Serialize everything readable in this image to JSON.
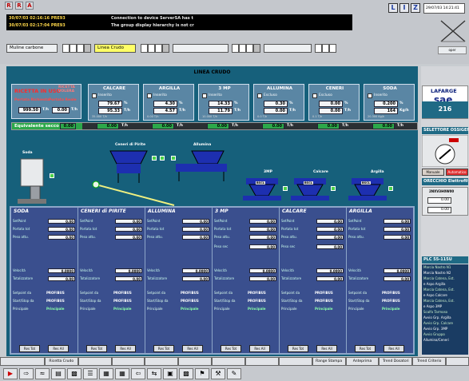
{
  "alarms": [
    {
      "date": "30/07/03 02:16:16 PRE93",
      "text": "Connection to device ServerSA has t"
    },
    {
      "date": "30/07/03 02:17:04 PRE93",
      "text": "The group display hierarchy is not cr"
    }
  ],
  "toolbar": {
    "icon1": "R",
    "icon2": "R",
    "icon3": "A"
  },
  "sysbuttons": [
    "L",
    "I",
    "Z"
  ],
  "clock": "29/07/03 14:21:41",
  "user_field": "oper",
  "nav": {
    "tab1": "Muline carbone",
    "tab2": "Linea Crudo"
  },
  "panel": {
    "title": "LINEA CRUDO"
  },
  "recipe": {
    "label": "RICETTA IN USO",
    "sub_right": "RICETTA VOLERA",
    "portata_richiesta": "Portata Richiesta",
    "portata_reale": "Portata Reale",
    "val1": "999.50",
    "val2": "0.00",
    "unit": "T/h"
  },
  "equivalent": {
    "label": "Equivalente secco",
    "v0": "0.00",
    "unit": "T/h"
  },
  "materials": [
    {
      "name": "CALCARE",
      "ins": "Inserito",
      "v1": "79.67",
      "u1": "%",
      "v2": "95.33",
      "u2": "T/h",
      "small": "35.000 T/h",
      "eq": "0.00"
    },
    {
      "name": "ARGILLA",
      "ins": "Inserito",
      "v1": "4.30",
      "u1": "%",
      "v2": "4.57",
      "u2": "T/h",
      "small": "0.00 T/h",
      "eq": "0.00"
    },
    {
      "name": "3 MP",
      "ins": "Inserito",
      "v1": "14.33",
      "u1": "%",
      "v2": "11.79",
      "u2": "T/h",
      "small": "10.000 T/h",
      "eq": "0.00"
    },
    {
      "name": "ALLUMINA",
      "ins": "Escluso",
      "v1": "0.30",
      "u1": "%",
      "v2": "0.00",
      "u2": "T/h",
      "small": "0.0 T/h",
      "eq": "0.00"
    },
    {
      "name": "CENERI",
      "ins": "Escluso",
      "v1": "0.00",
      "u1": "%",
      "v2": "0.00",
      "u2": "T/h",
      "small": "0.1 T/h",
      "eq": "0.00"
    },
    {
      "name": "SODA",
      "ins": "Inserito",
      "v1": "0.200",
      "u1": "%",
      "v2": "164",
      "u2": "Kg/h",
      "small": "20.300 Kg/h",
      "eq": "0.00"
    }
  ],
  "machines": {
    "soda": "Soda",
    "ceneri": "Ceneri di Pirite",
    "allumina": "Allumina",
    "smp": "3MP",
    "calcare": "Calcare",
    "argilla": "Argilla",
    "nastro1": "NASTRO N1",
    "nastro2": "NASTRO N2",
    "hopper_tag": "BSCL"
  },
  "controls": [
    {
      "title": "SODA",
      "sp": "0.00",
      "pt": "0.00",
      "pa": "0.00",
      "ps": "",
      "vel": "0.0000",
      "tot": "0.00",
      "profibus": "PROFIBUS",
      "profibus2": "PROFIBUS",
      "principale": "Principale"
    },
    {
      "title": "CENERI di PIRITE",
      "sp": "0.00",
      "pt": "0.00",
      "pa": "0.00",
      "ps": "",
      "vel": "0.0000",
      "tot": "0.00",
      "profibus": "PROFIBUS",
      "profibus2": "PROFIBUS",
      "principale": "Principale"
    },
    {
      "title": "ALLUMINA",
      "sp": "0.00",
      "pt": "0.00",
      "pa": "0.00",
      "ps": "",
      "vel": "0.0000",
      "tot": "0.00",
      "profibus": "PROFIBUS",
      "profibus2": "PROFIBUS",
      "principale": "Principale"
    },
    {
      "title": "3 MP",
      "sp": "0.00",
      "pt": "0.00",
      "pa": "0.00",
      "ps": "0.00",
      "vel": "0.0000",
      "tot": "0.00",
      "profibus": "PROFIBUS",
      "profibus2": "PROFIBUS",
      "principale": "Principale"
    },
    {
      "title": "CALCARE",
      "sp": "0.00",
      "pt": "0.00",
      "pa": "0.00",
      "ps": "0.00",
      "vel": "0.0000",
      "tot": "0.00",
      "profibus": "PROFIBUS",
      "profibus2": "PROFIBUS",
      "principale": "Principale"
    },
    {
      "title": "ARGILLA",
      "sp": "0.00",
      "pt": "0.00",
      "pa": "0.00",
      "ps": "",
      "vel": "0.0000",
      "tot": "0.00",
      "profibus": "PROFIBUS",
      "profibus2": "PROFIBUS",
      "principale": "Principale"
    }
  ],
  "row_labels": {
    "sp": "SetPoint",
    "pt": "Portata tot",
    "pa": "Peso attu.",
    "ps": "Peso sec",
    "vel": "Velocità",
    "tot": "Totalizzatore",
    "sorg": "Setpoint da",
    "stat": "Start/Stop da",
    "princ": "Principale",
    "btn_tot": "Res Tot",
    "btn_all": "Res All"
  },
  "right_panel": {
    "logo": "LAFARGE",
    "logo_sub": "sae",
    "number": "216",
    "hdr1": "SELETTORE OSSIGENO",
    "btn_a": "Manuale",
    "btn_b": "Automatico",
    "hdr2": "ORECCHIO Elettrofiltro",
    "field1": "2NXV3H0W00",
    "val_a": "0.00",
    "val_b": "0.00",
    "hdr3": "PLC 55-115U",
    "list": [
      "Marcia Nastro N1",
      "Marcia Nastro N2",
      "Marcia Catena, Est.",
      "e Aspo Argilla",
      "Marcia Catena, Est.",
      "e Aspo Calcare",
      "Marcia Catena, Est.",
      "e Aspo 3MP",
      "Scalfo Tarmoso",
      "Avvio Grp. Argilla",
      "Avvio Grp. Calcare",
      "Avvio Grp. 3MP",
      "Avvio Gruppo",
      "Allumina/Ceneri"
    ]
  },
  "fkeys": [
    "",
    "Ricetta Crudo",
    "",
    "",
    "",
    "",
    "",
    "",
    "",
    "Range Stampa",
    "Anteprima",
    "Trend Dosatori",
    "Trend Criterio",
    ""
  ]
}
